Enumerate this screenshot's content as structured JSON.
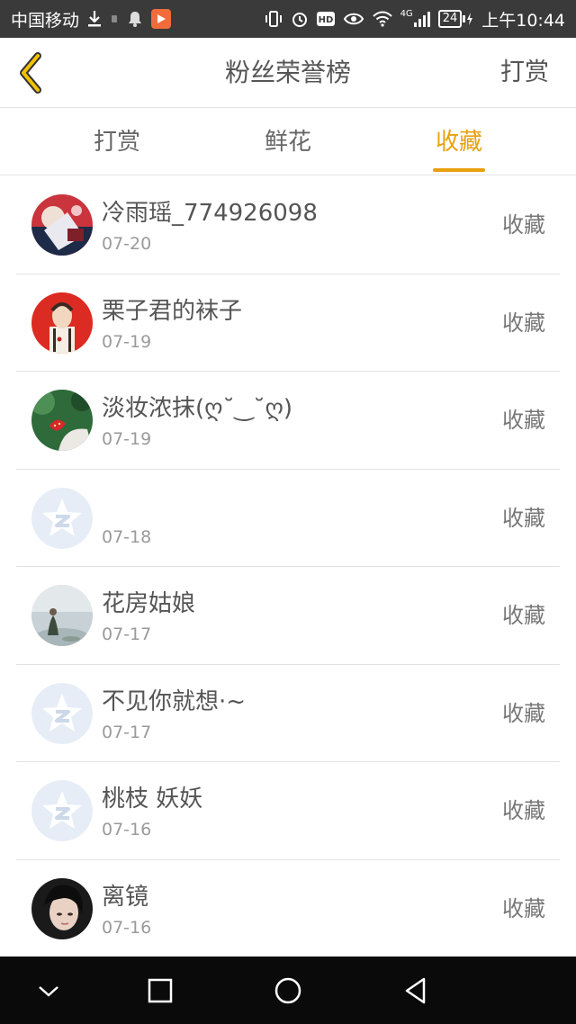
{
  "status_bar": {
    "carrier": "中国移动",
    "network": "4G",
    "battery": "24",
    "time": "上午10:44"
  },
  "header": {
    "title": "粉丝荣誉榜",
    "right_action": "打赏"
  },
  "tabs": [
    {
      "label": "打赏",
      "active": false
    },
    {
      "label": "鲜花",
      "active": false
    },
    {
      "label": "收藏",
      "active": true
    }
  ],
  "colors": {
    "accent": "#e8a10e",
    "status_bar": "#3a3a3a",
    "nav_bar": "#0a0a0a",
    "text": "#555555",
    "subtext": "#9a9a9a",
    "divider": "#e2e2e2"
  },
  "list": [
    {
      "name": "冷雨瑶_774926098",
      "date": "07-20",
      "action": "收藏",
      "avatar": "photo"
    },
    {
      "name": "栗子君的袜子",
      "date": "07-19",
      "action": "收藏",
      "avatar": "photo"
    },
    {
      "name": "淡妆浓抹(ღ˘‿˘ღ)",
      "date": "07-19",
      "action": "收藏",
      "avatar": "photo"
    },
    {
      "name": "",
      "date": "07-18",
      "action": "收藏",
      "avatar": "default-star"
    },
    {
      "name": "花房姑娘",
      "date": "07-17",
      "action": "收藏",
      "avatar": "photo"
    },
    {
      "name": "不见你就想·~",
      "date": "07-17",
      "action": "收藏",
      "avatar": "default-star"
    },
    {
      "name": "桃枝 妖妖",
      "date": "07-16",
      "action": "收藏",
      "avatar": "default-star"
    },
    {
      "name": "离镜",
      "date": "07-16",
      "action": "收藏",
      "avatar": "photo"
    }
  ]
}
